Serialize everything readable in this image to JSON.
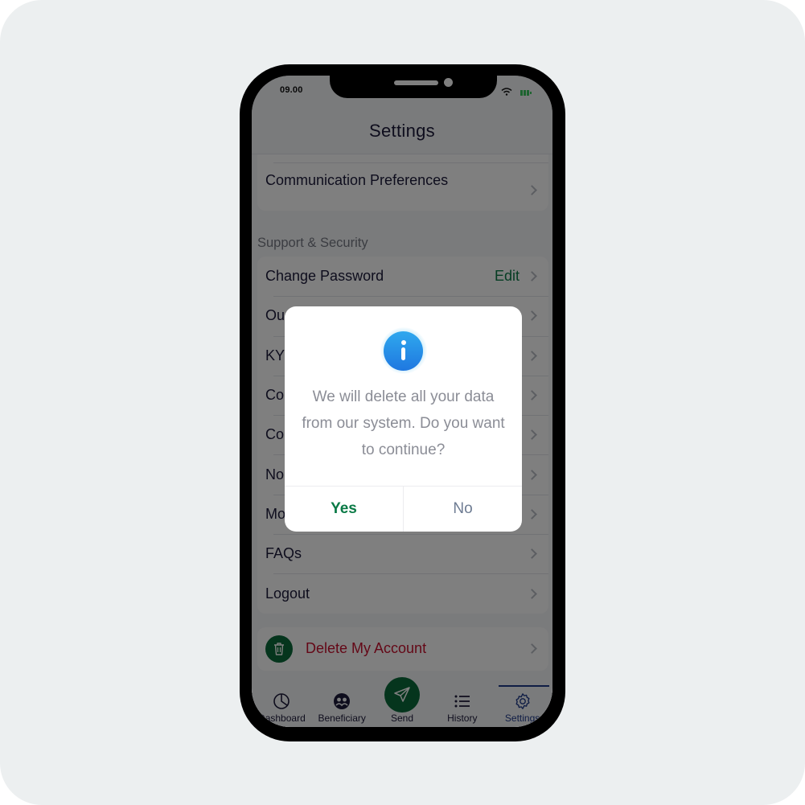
{
  "status_bar": {
    "time": "09.00",
    "wifi_icon": "wifi-icon",
    "battery_icon": "battery-icon"
  },
  "header": {
    "title": "Settings"
  },
  "preferences_card": {
    "items": [
      {
        "label": "Communication Preferences",
        "icon": "chevron-right-icon"
      }
    ]
  },
  "support_section": {
    "title": "Support & Security",
    "items": [
      {
        "label": "Change Password",
        "action": "Edit",
        "icon": "chevron-right-icon"
      },
      {
        "label": "Ou",
        "icon": "chevron-right-icon"
      },
      {
        "label": "KY",
        "icon": "chevron-right-icon"
      },
      {
        "label": "Co",
        "icon": "chevron-right-icon"
      },
      {
        "label": "Co",
        "icon": "chevron-right-icon"
      },
      {
        "label": "No",
        "icon": "chevron-right-icon"
      },
      {
        "label": "Mo",
        "icon": "chevron-right-icon"
      },
      {
        "label": "FAQs",
        "icon": "chevron-right-icon"
      },
      {
        "label": "Logout",
        "icon": "chevron-right-icon"
      }
    ]
  },
  "delete_account": {
    "label": "Delete My Account",
    "icon": "trash-icon"
  },
  "tabbar": {
    "tabs": [
      {
        "label": "Dashboard",
        "icon": "pie-chart-icon",
        "active": false
      },
      {
        "label": "Beneficiary",
        "icon": "users-icon",
        "active": false
      },
      {
        "label": "Send",
        "icon": "send-icon",
        "active": false
      },
      {
        "label": "History",
        "icon": "list-icon",
        "active": false
      },
      {
        "label": "Settings",
        "icon": "gear-icon",
        "active": true
      }
    ]
  },
  "dialog": {
    "icon": "info-icon",
    "message": "We will delete all your data from our system. Do you want to continue?",
    "yes_label": "Yes",
    "no_label": "No"
  },
  "colors": {
    "accent_green": "#0a6b3a",
    "edit_green": "#0a7a46",
    "danger_red": "#c8102e",
    "active_tab_blue": "#1f3a8a",
    "info_blue": "#1f78e0"
  }
}
